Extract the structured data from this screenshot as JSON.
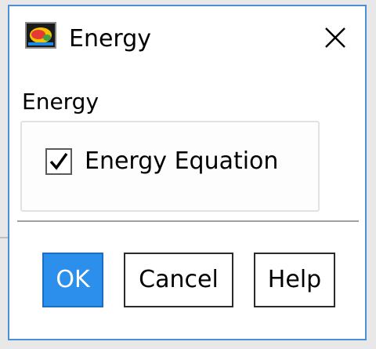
{
  "window": {
    "title": "Energy",
    "app_icon": "fluent-app-icon",
    "close_icon": "close-icon"
  },
  "section": {
    "label": "Energy"
  },
  "options": {
    "energy_equation": {
      "label": "Energy Equation",
      "checked": true
    }
  },
  "buttons": {
    "ok": "OK",
    "cancel": "Cancel",
    "help": "Help"
  },
  "colors": {
    "accent": "#2d8fec",
    "window_border": "#4a90d9"
  }
}
